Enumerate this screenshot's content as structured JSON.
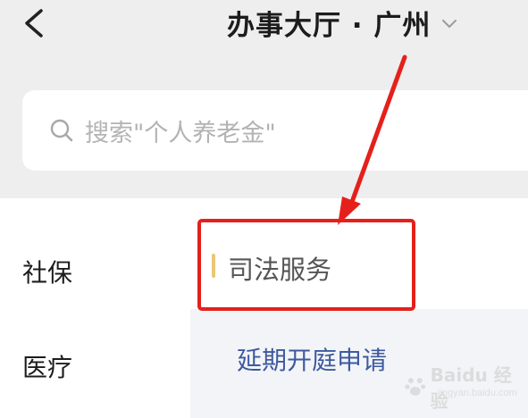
{
  "header": {
    "back_icon": "chevron-left-icon",
    "title": "办事大厅 · 广州",
    "title_dropdown_icon": "chevron-down-icon"
  },
  "search": {
    "icon": "search-icon",
    "placeholder": "搜索\"个人养老金\""
  },
  "sidebar": {
    "items": [
      {
        "label": "社保"
      },
      {
        "label": "医疗"
      }
    ]
  },
  "content": {
    "section_title": "司法服务",
    "items": [
      {
        "label": "延期开庭申请"
      }
    ]
  },
  "annotation": {
    "arrow_color": "#e5201b",
    "highlight_color": "#e5201b"
  },
  "watermark": {
    "text": "Baidu 经验",
    "sub": "jingyan.baidu.com"
  },
  "colors": {
    "accent": "#ecc57a",
    "link": "#3d5a9e",
    "header_bg": "#eeeeee"
  }
}
